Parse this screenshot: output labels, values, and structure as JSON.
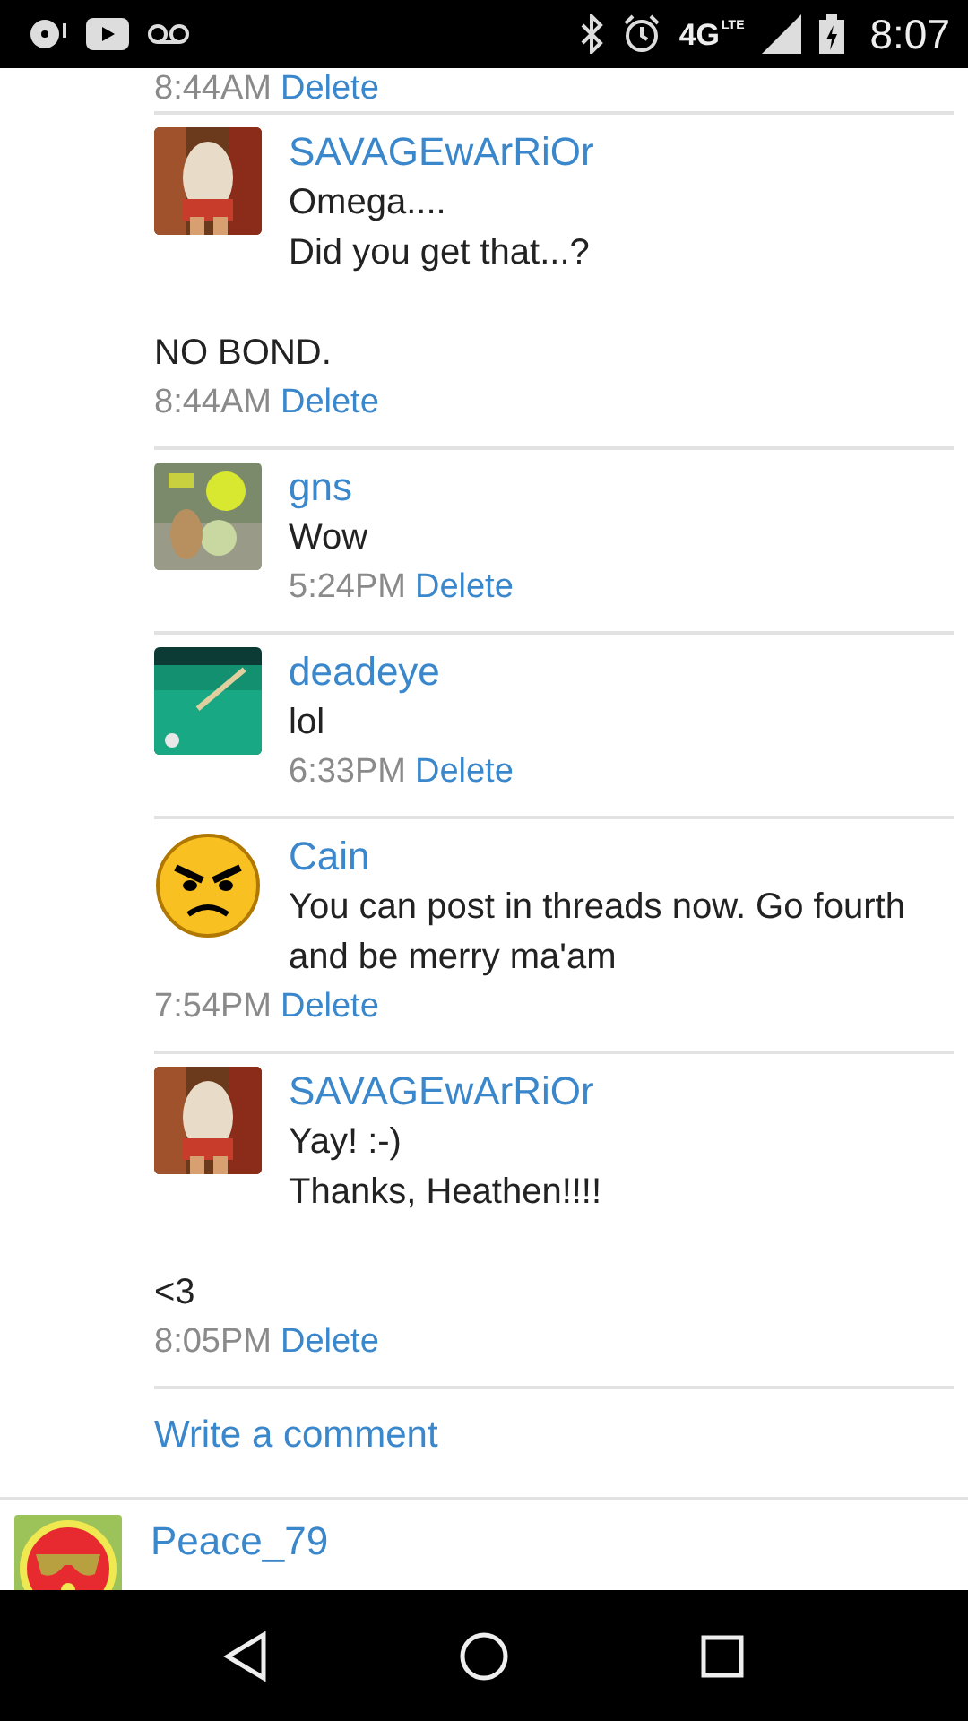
{
  "status_bar": {
    "network": "4G",
    "network_sub": "LTE",
    "time": "8:07"
  },
  "cut_meta": {
    "time": "8:44AM",
    "action": "Delete"
  },
  "comments": [
    {
      "author": "SAVAGEwArRiOr",
      "text": "Omega....\nDid you get that...?",
      "after": "NO BOND.",
      "time": "8:44AM",
      "action": "Delete"
    },
    {
      "author": "gns",
      "text": "Wow",
      "time": "5:24PM",
      "action": "Delete"
    },
    {
      "author": "deadeye",
      "text": "lol",
      "time": "6:33PM",
      "action": "Delete"
    },
    {
      "author": "Cain",
      "avatar": {
        "kind": "angry-emoji"
      },
      "text": "You can post in threads now. Go fourth and be merry ma'am",
      "time": "7:54PM",
      "action": "Delete"
    },
    {
      "author": "SAVAGEwArRiOr",
      "text": "Yay! :-)\nThanks, Heathen!!!!",
      "after": "<3",
      "time": "8:05PM",
      "action": "Delete"
    }
  ],
  "write_comment": "Write a comment",
  "next_post": {
    "author": "Peace_79",
    "avatar": {
      "kind": "sunglasses-badge"
    }
  }
}
